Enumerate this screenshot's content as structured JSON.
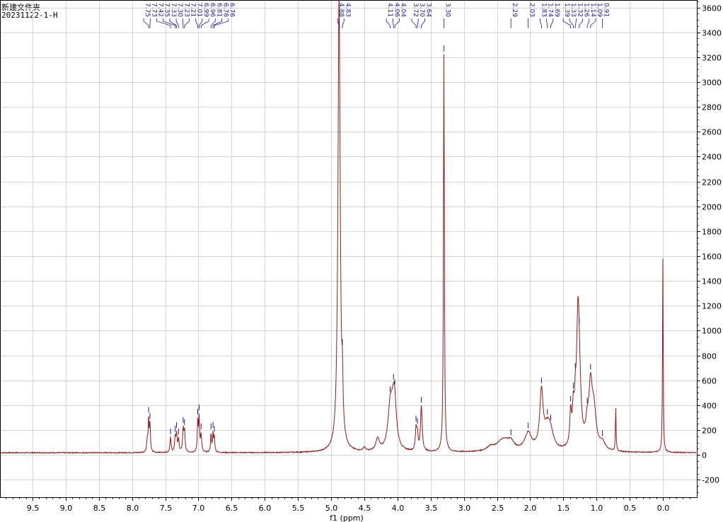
{
  "header": {
    "folder": "新建文件夹",
    "sample": "20231122-1-H"
  },
  "chart_data": {
    "type": "line",
    "title": "",
    "xlabel": "f1 (ppm)",
    "ylabel": "",
    "x_reversed": true,
    "xlim": [
      -0.5,
      10.0
    ],
    "ylim": [
      -340,
      3660
    ],
    "x_ticks": [
      "9.5",
      "9.0",
      "8.5",
      "8.0",
      "7.5",
      "7.0",
      "6.5",
      "6.0",
      "5.5",
      "5.0",
      "4.5",
      "4.0",
      "3.5",
      "3.0",
      "2.5",
      "2.0",
      "1.5",
      "1.0",
      "0.5",
      "0.0"
    ],
    "x_tick_values": [
      9.5,
      9.0,
      8.5,
      8.0,
      7.5,
      7.0,
      6.5,
      6.0,
      5.5,
      5.0,
      4.5,
      4.0,
      3.5,
      3.0,
      2.5,
      2.0,
      1.5,
      1.0,
      0.5,
      0.0
    ],
    "y_ticks": [
      "-200",
      "0",
      "200",
      "400",
      "600",
      "800",
      "1000",
      "1200",
      "1400",
      "1600",
      "1800",
      "2000",
      "2200",
      "2400",
      "2600",
      "2800",
      "3000",
      "3200",
      "3400",
      "3600"
    ],
    "y_tick_values": [
      -200,
      0,
      200,
      400,
      600,
      800,
      1000,
      1200,
      1400,
      1600,
      1800,
      2000,
      2200,
      2400,
      2600,
      2800,
      3000,
      3200,
      3400,
      3600
    ],
    "grid": true,
    "line_color": "#8b1a1a",
    "label_color": "#1a1a8c",
    "baseline": 18,
    "peaks": [
      {
        "ppm": 7.77,
        "height": 100,
        "width": 0.01
      },
      {
        "ppm": 7.75,
        "height": 250,
        "width": 0.008
      },
      {
        "ppm": 7.73,
        "height": 210,
        "width": 0.008
      },
      {
        "ppm": 7.42,
        "height": 120,
        "width": 0.01
      },
      {
        "ppm": 7.35,
        "height": 110,
        "width": 0.01
      },
      {
        "ppm": 7.33,
        "height": 140,
        "width": 0.01
      },
      {
        "ppm": 7.3,
        "height": 100,
        "width": 0.01
      },
      {
        "ppm": 7.23,
        "height": 180,
        "width": 0.01
      },
      {
        "ppm": 7.21,
        "height": 160,
        "width": 0.01
      },
      {
        "ppm": 7.01,
        "height": 240,
        "width": 0.008
      },
      {
        "ppm": 6.99,
        "height": 270,
        "width": 0.008
      },
      {
        "ppm": 6.96,
        "height": 140,
        "width": 0.01
      },
      {
        "ppm": 6.81,
        "height": 150,
        "width": 0.008
      },
      {
        "ppm": 6.78,
        "height": 150,
        "width": 0.008
      },
      {
        "ppm": 6.76,
        "height": 120,
        "width": 0.008
      },
      {
        "ppm": 4.88,
        "height": 3700,
        "width": 0.02
      },
      {
        "ppm": 4.83,
        "height": 330,
        "width": 0.01
      },
      {
        "ppm": 4.5,
        "height": 30,
        "width": 0.02
      },
      {
        "ppm": 4.3,
        "height": 100,
        "width": 0.03
      },
      {
        "ppm": 4.11,
        "height": 310,
        "width": 0.04
      },
      {
        "ppm": 4.06,
        "height": 300,
        "width": 0.04
      },
      {
        "ppm": 4.04,
        "height": 200,
        "width": 0.03
      },
      {
        "ppm": 3.72,
        "height": 170,
        "width": 0.012
      },
      {
        "ppm": 3.7,
        "height": 130,
        "width": 0.012
      },
      {
        "ppm": 3.64,
        "height": 360,
        "width": 0.015
      },
      {
        "ppm": 3.3,
        "height": 3200,
        "width": 0.008
      },
      {
        "ppm": 2.6,
        "height": 30,
        "width": 0.06
      },
      {
        "ppm": 2.4,
        "height": 100,
        "width": 0.12
      },
      {
        "ppm": 2.29,
        "height": 50,
        "width": 0.05
      },
      {
        "ppm": 2.03,
        "height": 140,
        "width": 0.06
      },
      {
        "ppm": 1.83,
        "height": 450,
        "width": 0.03
      },
      {
        "ppm": 1.74,
        "height": 170,
        "width": 0.06
      },
      {
        "ppm": 1.69,
        "height": 100,
        "width": 0.05
      },
      {
        "ppm": 1.39,
        "height": 260,
        "width": 0.015
      },
      {
        "ppm": 1.35,
        "height": 250,
        "width": 0.015
      },
      {
        "ppm": 1.32,
        "height": 230,
        "width": 0.015
      },
      {
        "ppm": 1.28,
        "height": 900,
        "width": 0.025
      },
      {
        "ppm": 1.26,
        "height": 400,
        "width": 0.03
      },
      {
        "ppm": 1.14,
        "height": 150,
        "width": 0.03
      },
      {
        "ppm": 1.09,
        "height": 450,
        "width": 0.03
      },
      {
        "ppm": 1.04,
        "height": 300,
        "width": 0.04
      },
      {
        "ppm": 0.91,
        "height": 60,
        "width": 0.05
      },
      {
        "ppm": 0.71,
        "height": 350,
        "width": 0.006
      },
      {
        "ppm": 0.0,
        "height": 1560,
        "width": 0.006
      }
    ],
    "peak_labels": [
      {
        "text": "7.75",
        "ppm": 7.75
      },
      {
        "text": "7.73",
        "ppm": 7.73
      },
      {
        "text": "7.42",
        "ppm": 7.42
      },
      {
        "text": "7.35",
        "ppm": 7.35
      },
      {
        "text": "7.33",
        "ppm": 7.33
      },
      {
        "text": "7.30",
        "ppm": 7.3
      },
      {
        "text": "7.23",
        "ppm": 7.23
      },
      {
        "text": "7.21",
        "ppm": 7.21
      },
      {
        "text": "7.01",
        "ppm": 7.01
      },
      {
        "text": "6.99",
        "ppm": 6.99
      },
      {
        "text": "6.96",
        "ppm": 6.96
      },
      {
        "text": "6.81",
        "ppm": 6.81
      },
      {
        "text": "6.78",
        "ppm": 6.78
      },
      {
        "text": "6.76",
        "ppm": 6.76
      },
      {
        "text": "4.88",
        "ppm": 4.88
      },
      {
        "text": "4.83",
        "ppm": 4.83
      },
      {
        "text": "4.11",
        "ppm": 4.11
      },
      {
        "text": "4.06",
        "ppm": 4.06
      },
      {
        "text": "4.04",
        "ppm": 4.04
      },
      {
        "text": "3.72",
        "ppm": 3.72
      },
      {
        "text": "3.70",
        "ppm": 3.7
      },
      {
        "text": "3.64",
        "ppm": 3.64
      },
      {
        "text": "3.30",
        "ppm": 3.3
      },
      {
        "text": "2.29",
        "ppm": 2.29
      },
      {
        "text": "2.03",
        "ppm": 2.03
      },
      {
        "text": "1.83",
        "ppm": 1.83
      },
      {
        "text": "1.74",
        "ppm": 1.74
      },
      {
        "text": "1.69",
        "ppm": 1.69
      },
      {
        "text": "1.39",
        "ppm": 1.39
      },
      {
        "text": "1.33",
        "ppm": 1.35
      },
      {
        "text": "1.32",
        "ppm": 1.32
      },
      {
        "text": "1.26",
        "ppm": 1.26
      },
      {
        "text": "1.14",
        "ppm": 1.14
      },
      {
        "text": "1.09",
        "ppm": 1.09
      },
      {
        "text": "0.91",
        "ppm": 0.91
      }
    ]
  }
}
